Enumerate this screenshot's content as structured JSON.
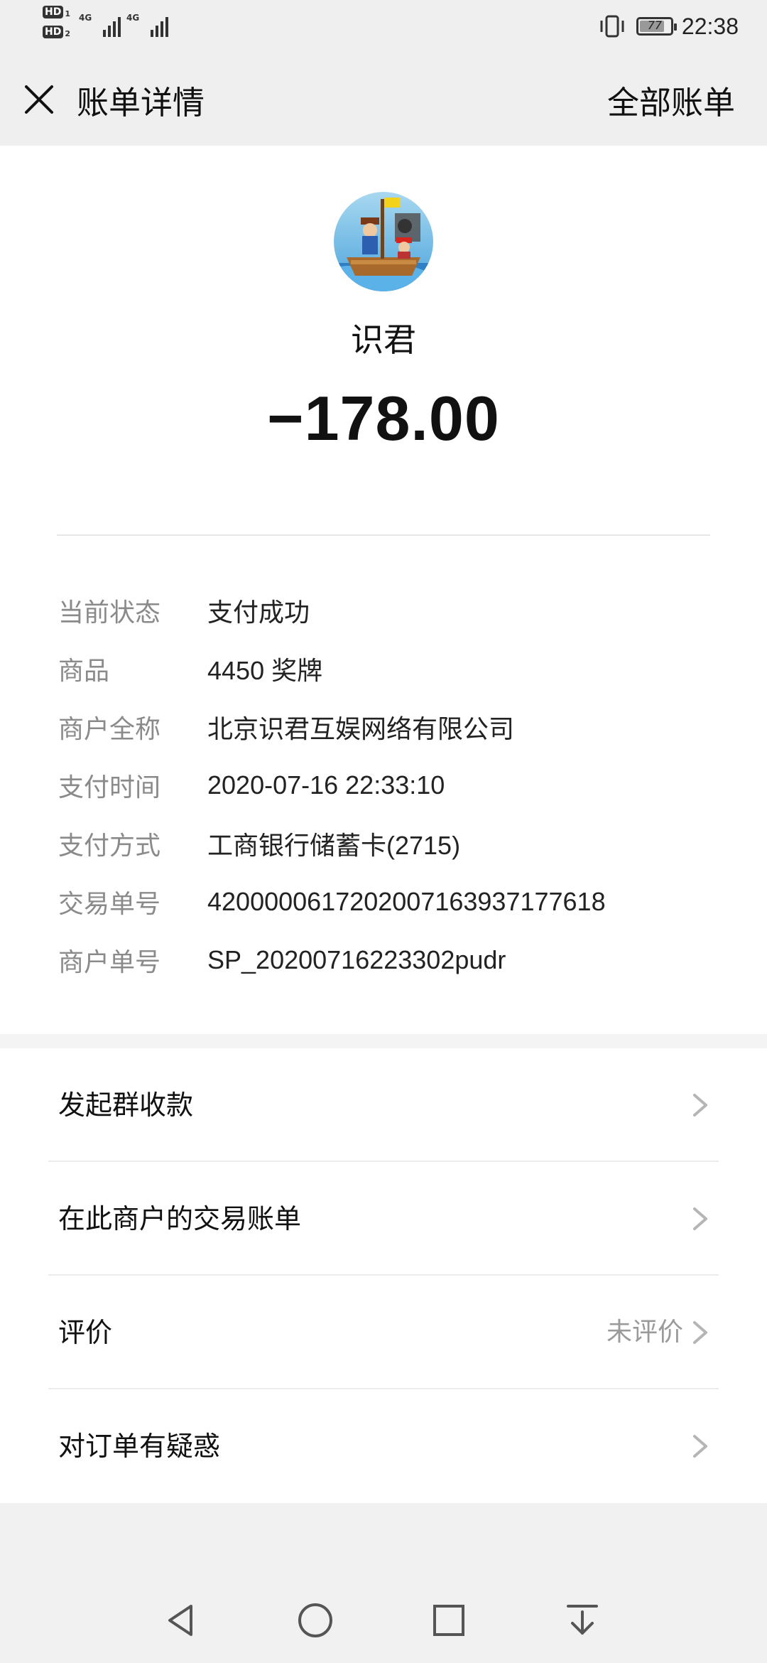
{
  "status_bar": {
    "hd1": "HD",
    "hd1_sub": "1",
    "hd2": "HD",
    "hd2_sub": "2",
    "net1": "4G",
    "net2": "4G",
    "battery": "77",
    "time": "22:38"
  },
  "navbar": {
    "title": "账单详情",
    "action": "全部账单"
  },
  "merchant": {
    "name": "识君",
    "amount": "−178.00"
  },
  "details": [
    {
      "label": "当前状态",
      "value": "支付成功"
    },
    {
      "label": "商品",
      "value": "4450 奖牌"
    },
    {
      "label": "商户全称",
      "value": "北京识君互娱网络有限公司"
    },
    {
      "label": "支付时间",
      "value": "2020-07-16 22:33:10"
    },
    {
      "label": "支付方式",
      "value": "工商银行储蓄卡(2715)"
    },
    {
      "label": "交易单号",
      "value": "4200000617202007163937177618"
    },
    {
      "label": "商户单号",
      "value": "SP_20200716223302pudr"
    }
  ],
  "menu": [
    {
      "label": "发起群收款",
      "status": ""
    },
    {
      "label": "在此商户的交易账单",
      "status": ""
    },
    {
      "label": "评价",
      "status": "未评价"
    },
    {
      "label": "对订单有疑惑",
      "status": ""
    }
  ]
}
